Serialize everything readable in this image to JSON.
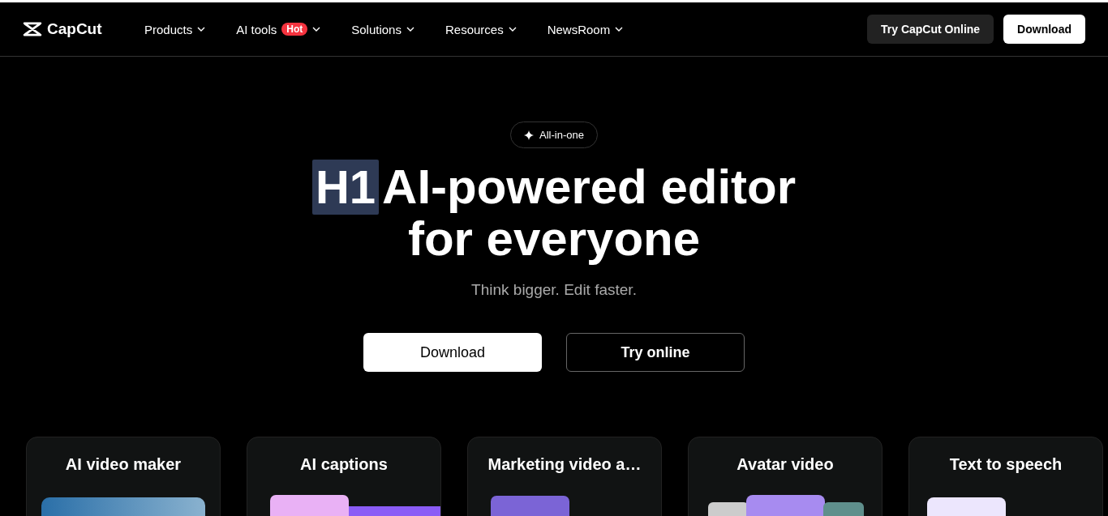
{
  "header": {
    "logo": "CapCut",
    "nav": [
      {
        "label": "Products"
      },
      {
        "label": "AI tools",
        "badge": "Hot"
      },
      {
        "label": "Solutions"
      },
      {
        "label": "Resources"
      },
      {
        "label": "NewsRoom"
      }
    ],
    "actions": [
      {
        "label": "Try CapCut Online",
        "kind": "secondary"
      },
      {
        "label": "Download",
        "kind": "primary"
      }
    ]
  },
  "hero": {
    "pill": "All-in-one",
    "heading_tag": "H1",
    "heading_line_1": "AI-powered editor",
    "heading_line_2": "for everyone",
    "subtitle": "Think bigger. Edit faster.",
    "buttons": [
      {
        "label": "Download",
        "kind": "primary"
      },
      {
        "label": "Try online",
        "kind": "outline"
      }
    ]
  },
  "cards": [
    {
      "title": "AI video maker",
      "kind": "photo"
    },
    {
      "title": "AI captions",
      "kind": "caption"
    },
    {
      "title": "Marketing video a…",
      "kind": "window"
    },
    {
      "title": "Avatar video",
      "kind": "avatar"
    },
    {
      "title": "Text to speech",
      "kind": "text"
    }
  ]
}
